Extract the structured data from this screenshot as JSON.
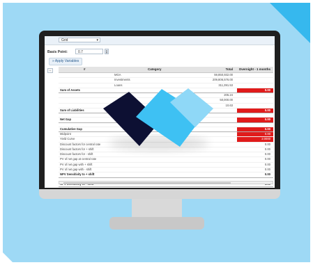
{
  "toolbar": {
    "grid_select": "Grid"
  },
  "basis": {
    "label": "Basis Point:",
    "value": "0.7"
  },
  "apply_button": "Apply Variables",
  "table": {
    "headers": [
      "#",
      "Category",
      "Total",
      "Overnight - 1 months"
    ],
    "rows": [
      {
        "name": "",
        "category": "MGA",
        "total": "59,850,932.00",
        "over": "",
        "bold": false,
        "red": false
      },
      {
        "name": "",
        "category": "Investments",
        "total": "209,806,576.00",
        "over": "",
        "bold": false,
        "red": false
      },
      {
        "name": "",
        "category": "Loans",
        "total": "311,391.53",
        "over": "",
        "bold": false,
        "red": false
      },
      {
        "name": "Sum of Assets",
        "category": "",
        "total": "",
        "over": "0.00",
        "bold": true,
        "red": true
      },
      {
        "name": "",
        "category": "",
        "total": "205.24",
        "over": "",
        "bold": false,
        "red": false
      },
      {
        "name": "",
        "category": "",
        "total": "50,000.00",
        "over": "",
        "bold": false,
        "red": false
      },
      {
        "name": "",
        "category": "",
        "total": "10.63",
        "over": "",
        "bold": false,
        "red": false
      },
      {
        "name": "Sum of Liabilities",
        "category": "",
        "total": "",
        "over": "0.00",
        "bold": true,
        "red": true
      },
      {
        "name": "",
        "category": "",
        "total": "",
        "over": "",
        "bold": false,
        "red": false,
        "spacer": true
      },
      {
        "name": "Net Gap",
        "category": "",
        "total": "",
        "over": "0.00",
        "bold": true,
        "red": true
      },
      {
        "name": "",
        "category": "",
        "total": "",
        "over": "",
        "bold": false,
        "red": false,
        "spacer": true
      },
      {
        "name": "Cumulative Gap",
        "category": "",
        "total": "",
        "over": "0.00",
        "bold": true,
        "red": true
      },
      {
        "name": "Midpoint",
        "category": "",
        "total": "",
        "over": "0.00",
        "bold": false,
        "red": true
      },
      {
        "name": "Yield Curve",
        "category": "",
        "total": "",
        "over": "2.0000",
        "bold": false,
        "red": true
      },
      {
        "name": "Discount factors for central rate",
        "category": "",
        "total": "",
        "over": "0.00",
        "bold": false,
        "red": false
      },
      {
        "name": "Discount factors for + shift",
        "category": "",
        "total": "",
        "over": "0.00",
        "bold": false,
        "red": false
      },
      {
        "name": "Discount factors for - shift",
        "category": "",
        "total": "",
        "over": "0.00",
        "bold": false,
        "red": false
      },
      {
        "name": "PV of net gap at central rate",
        "category": "",
        "total": "",
        "over": "0.00",
        "bold": false,
        "red": false
      },
      {
        "name": "PV of net gap with + shift",
        "category": "",
        "total": "",
        "over": "0.00",
        "bold": false,
        "red": false
      },
      {
        "name": "PV of net gap with - shift",
        "category": "",
        "total": "",
        "over": "0.00",
        "bold": false,
        "red": false
      },
      {
        "name": "NPV Sensitivity to + shift",
        "category": "",
        "total": "",
        "over": "0.00",
        "bold": true,
        "red": false
      },
      {
        "name": "",
        "category": "",
        "total": "",
        "over": "",
        "bold": false,
        "red": false,
        "spacer": true
      },
      {
        "name": "NPV Sensitivity to - shift",
        "category": "",
        "total": "",
        "over": "0.00",
        "bold": true,
        "red": false
      }
    ]
  },
  "colors": {
    "background": "#9ed9f5",
    "accent_corner": "#36b8ee",
    "logo_dark": "#0d1033",
    "logo_blue": "#3ec1f3",
    "logo_light": "#8fd8f7",
    "alert_red": "#e01b1b"
  }
}
